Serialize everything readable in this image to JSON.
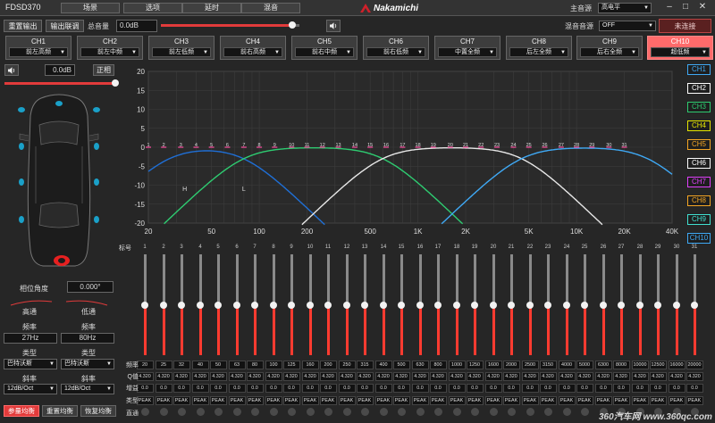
{
  "app": {
    "title": "FDSD370",
    "tabs": [
      "场景",
      "选项",
      "延时",
      "混音"
    ],
    "brand": "Nakamichi",
    "main_source_label": "主音源",
    "main_source_value": "高电平",
    "window_controls": [
      "–",
      "□",
      "✕"
    ]
  },
  "toolbar": {
    "reset_output": "重置输出",
    "output_link": "输出联调",
    "master_volume_label": "总音量",
    "master_volume_value": "0.0dB",
    "master_volume_level": 0.95,
    "mix_source_label": "混音音源",
    "mix_source_value": "OFF",
    "connect_status": "未连接"
  },
  "channels": [
    {
      "name": "CH1",
      "value": "前左高频"
    },
    {
      "name": "CH2",
      "value": "前左中频"
    },
    {
      "name": "CH3",
      "value": "前左低频"
    },
    {
      "name": "CH4",
      "value": "前右高频"
    },
    {
      "name": "CH5",
      "value": "前右中频"
    },
    {
      "name": "CH6",
      "value": "前右低频"
    },
    {
      "name": "CH7",
      "value": "中置全频"
    },
    {
      "name": "CH8",
      "value": "后左全频"
    },
    {
      "name": "CH9",
      "value": "后右全频"
    },
    {
      "name": "CH10",
      "value": "超低频"
    }
  ],
  "channel_ctrl": {
    "volume_value": "0.0dB",
    "phase_label": "正相",
    "volume_level": 1.0
  },
  "left_panel": {
    "phase_angle_label": "相位角度",
    "phase_angle_value": "0.000°",
    "high_pass_label": "高通",
    "low_pass_label": "低通",
    "freq_label": "频率",
    "high_pass_freq": "27Hz",
    "low_pass_freq": "80Hz",
    "type_label": "类型",
    "high_pass_type": "巴特沃斯",
    "low_pass_type": "巴特沃斯",
    "slope_label": "斜率",
    "high_pass_slope": "12dB/Oct",
    "low_pass_slope": "12dB/Oct"
  },
  "bottom_buttons": {
    "param_eq": "参量均衡",
    "reset_eq": "重置均衡",
    "restore_eq": "恢复均衡"
  },
  "graph": {
    "y_ticks": [
      "20",
      "15",
      "10",
      "5",
      "0",
      "-5",
      "-10",
      "-15",
      "-20"
    ],
    "x_ticks": [
      "20",
      "50",
      "100",
      "200",
      "500",
      "1K",
      "2K",
      "5K",
      "10K",
      "20K",
      "40K"
    ],
    "marker_h": "H",
    "marker_l": "L",
    "legend": [
      {
        "label": "CH1",
        "color": "#3fa9f5"
      },
      {
        "label": "CH2",
        "color": "#ffffff"
      },
      {
        "label": "CH3",
        "color": "#2ecc71"
      },
      {
        "label": "CH4",
        "color": "#e6e600"
      },
      {
        "label": "CH5",
        "color": "#f5a623"
      },
      {
        "label": "CH6",
        "color": "#ffffff"
      },
      {
        "label": "CH7",
        "color": "#e040fb"
      },
      {
        "label": "CH8",
        "color": "#f5a623"
      },
      {
        "label": "CH9",
        "color": "#40e0d0"
      },
      {
        "label": "CH10",
        "color": "#3fa9f5"
      }
    ]
  },
  "eq": {
    "band_label": "标号",
    "freq_label": "频率",
    "q_label": "Q值",
    "gain_label": "增益",
    "type_label": "类型",
    "bypass_label": "直通",
    "bands": [
      {
        "n": "1",
        "f": "20"
      },
      {
        "n": "2",
        "f": "25"
      },
      {
        "n": "3",
        "f": "32"
      },
      {
        "n": "4",
        "f": "40"
      },
      {
        "n": "5",
        "f": "50"
      },
      {
        "n": "6",
        "f": "63"
      },
      {
        "n": "7",
        "f": "80"
      },
      {
        "n": "8",
        "f": "100"
      },
      {
        "n": "9",
        "f": "125"
      },
      {
        "n": "10",
        "f": "160"
      },
      {
        "n": "11",
        "f": "200"
      },
      {
        "n": "12",
        "f": "250"
      },
      {
        "n": "13",
        "f": "315"
      },
      {
        "n": "14",
        "f": "400"
      },
      {
        "n": "15",
        "f": "500"
      },
      {
        "n": "16",
        "f": "630"
      },
      {
        "n": "17",
        "f": "800"
      },
      {
        "n": "18",
        "f": "1000"
      },
      {
        "n": "19",
        "f": "1250"
      },
      {
        "n": "20",
        "f": "1600"
      },
      {
        "n": "21",
        "f": "2000"
      },
      {
        "n": "22",
        "f": "2500"
      },
      {
        "n": "23",
        "f": "3150"
      },
      {
        "n": "24",
        "f": "4000"
      },
      {
        "n": "25",
        "f": "5000"
      },
      {
        "n": "26",
        "f": "6300"
      },
      {
        "n": "27",
        "f": "8000"
      },
      {
        "n": "28",
        "f": "10000"
      },
      {
        "n": "29",
        "f": "12500"
      },
      {
        "n": "30",
        "f": "16000"
      },
      {
        "n": "31",
        "f": "20000"
      }
    ],
    "q_value": "4.320",
    "gain_value": "0.0",
    "type_value": "PEAK",
    "gain_level": 0.0
  },
  "watermark": "360汽车网 www.360qc.com"
}
